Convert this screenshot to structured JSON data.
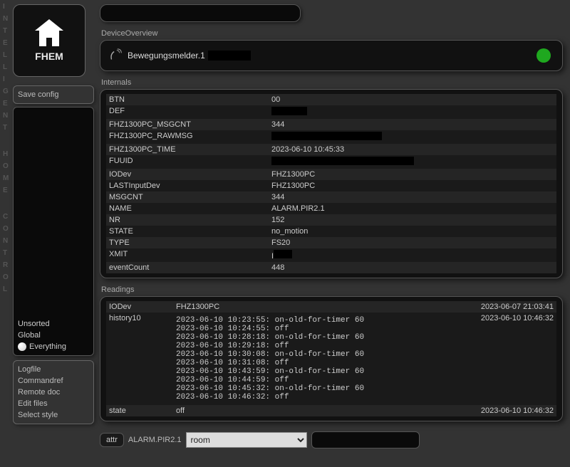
{
  "vert": [
    "I",
    "N",
    "T",
    "E",
    "L",
    "L",
    "I",
    "G",
    "E",
    "N",
    "T",
    "",
    "H",
    "O",
    "M",
    "E",
    "",
    "C",
    "O",
    "N",
    "T",
    "R",
    "O",
    "L"
  ],
  "logo": {
    "name": "FHEM"
  },
  "sidebar": {
    "save": "Save config",
    "rooms": [
      {
        "label": "Unsorted"
      },
      {
        "label": "Global"
      },
      {
        "label": "Everything",
        "icon": true
      }
    ],
    "links": [
      "Logfile",
      "Commandref",
      "Remote doc",
      "Edit files",
      "Select style"
    ]
  },
  "overview": {
    "title": "DeviceOverview",
    "name": "Bewegungsmelder.1"
  },
  "internals": {
    "title": "Internals",
    "rows": [
      {
        "k": "BTN",
        "v": "00"
      },
      {
        "k": "DEF",
        "v": "",
        "blk": 50
      },
      {
        "k": "FHZ1300PC_MSGCNT",
        "v": "344"
      },
      {
        "k": "FHZ1300PC_RAWMSG",
        "v": "",
        "blk": 155
      },
      {
        "k": "FHZ1300PC_TIME",
        "v": "2023-06-10 10:45:33"
      },
      {
        "k": "FUUID",
        "v": "",
        "blk": 200
      },
      {
        "k": "IODev",
        "v": "FHZ1300PC"
      },
      {
        "k": "LASTInputDev",
        "v": "FHZ1300PC"
      },
      {
        "k": "MSGCNT",
        "v": "344"
      },
      {
        "k": "NAME",
        "v": "ALARM.PIR2.1"
      },
      {
        "k": "NR",
        "v": "152"
      },
      {
        "k": "STATE",
        "v": "no_motion"
      },
      {
        "k": "TYPE",
        "v": "FS20"
      },
      {
        "k": "XMIT",
        "v": "",
        "pv": "I",
        "blk": 26
      },
      {
        "k": "eventCount",
        "v": "448"
      }
    ]
  },
  "readings": {
    "title": "Readings",
    "rows": [
      {
        "k": "IODev",
        "v": "FHZ1300PC",
        "ts": "2023-06-07 21:03:41"
      },
      {
        "k": "history10",
        "hist": "2023-06-10 10:23:55: on-old-for-timer 60\n2023-06-10 10:24:55: off\n2023-06-10 10:28:18: on-old-for-timer 60\n2023-06-10 10:29:18: off\n2023-06-10 10:30:08: on-old-for-timer 60\n2023-06-10 10:31:08: off\n2023-06-10 10:43:59: on-old-for-timer 60\n2023-06-10 10:44:59: off\n2023-06-10 10:45:32: on-old-for-timer 60\n2023-06-10 10:46:32: off",
        "ts": "2023-06-10 10:46:32"
      },
      {
        "k": "state",
        "v": "off",
        "ts": "2023-06-10 10:46:32"
      }
    ]
  },
  "attr": {
    "button": "attr",
    "device": "ALARM.PIR2.1",
    "options": [
      "room"
    ]
  }
}
